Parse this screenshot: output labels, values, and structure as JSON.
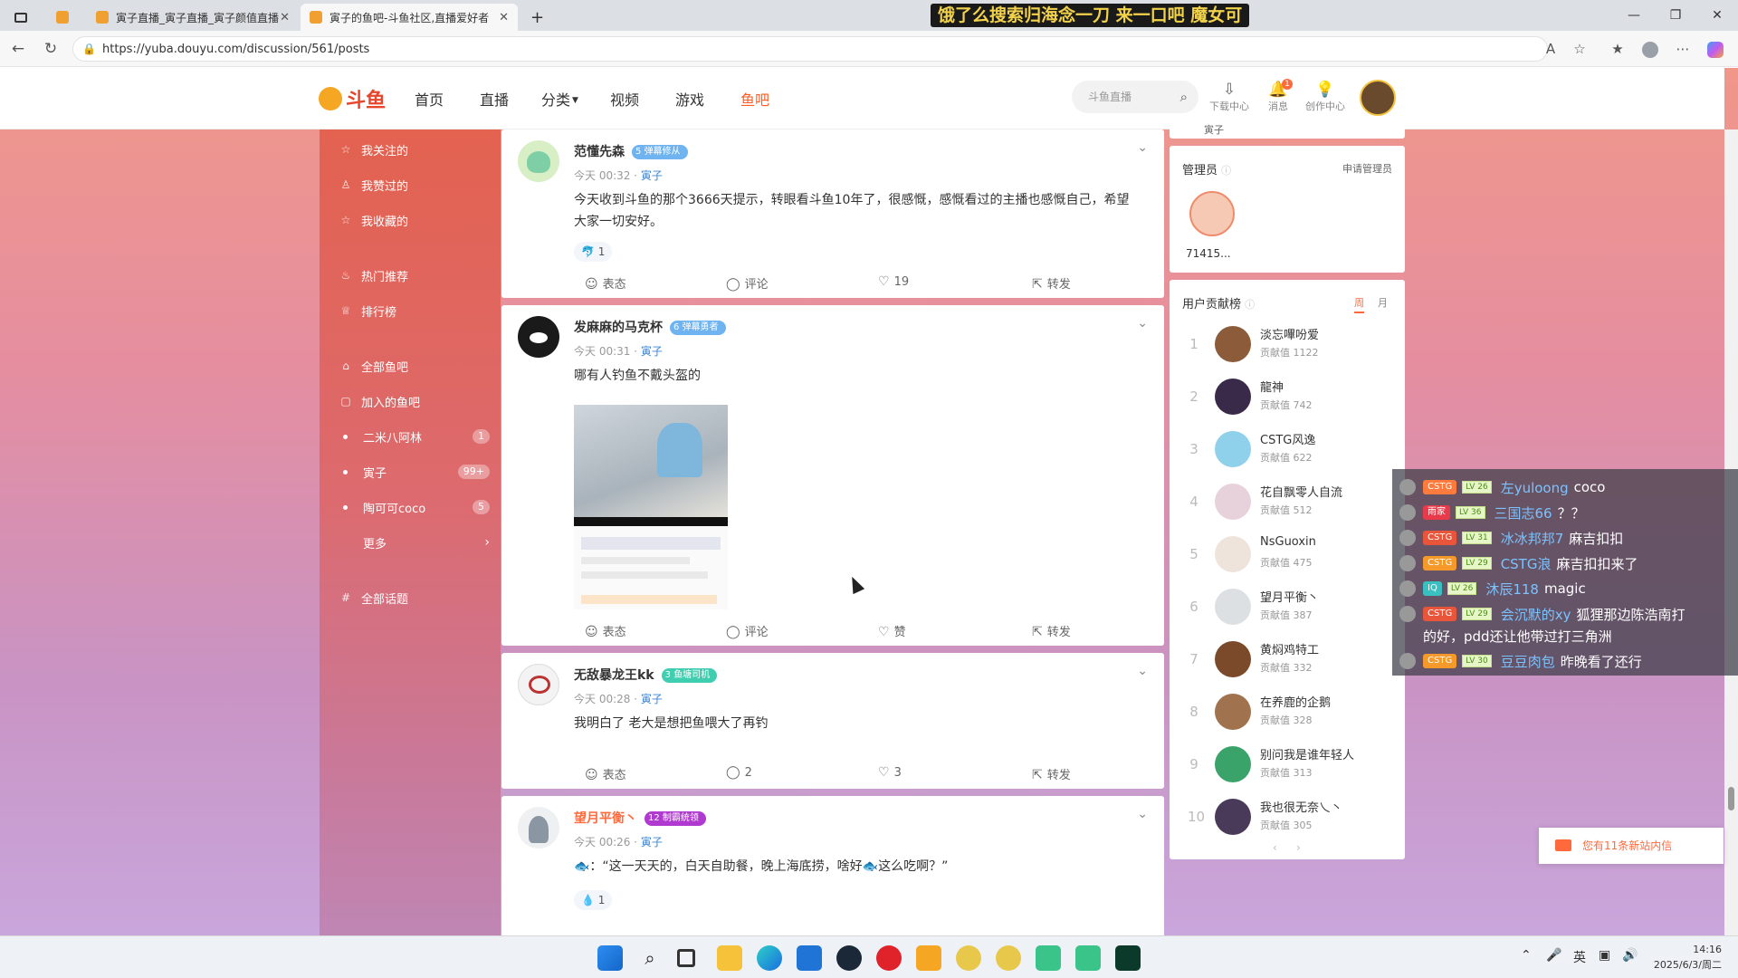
{
  "browser": {
    "tabs": [
      {
        "label": ""
      },
      {
        "label": "寅子直播_寅子直播_寅子颜值直播"
      },
      {
        "label": "寅子的鱼吧-斗鱼社区,直播爱好者"
      }
    ],
    "new_tab": "+",
    "overlay_title": "饿了么搜索归海念一刀 来一口吧 魔女可",
    "url": "https://yuba.douyu.com/discussion/561/posts",
    "minimize": "—",
    "maximize": "❐",
    "close": "✕"
  },
  "site": {
    "logo": "斗鱼",
    "nav": [
      "首页",
      "直播",
      "分类",
      "视频",
      "游戏",
      "鱼吧"
    ],
    "search_placeholder": "斗鱼直播",
    "icons": [
      {
        "label": "下载中心"
      },
      {
        "label": "消息",
        "badge": "1"
      },
      {
        "label": "创作中心"
      }
    ]
  },
  "sidebar": {
    "items": [
      {
        "label": "我关注的"
      },
      {
        "label": "我赞过的"
      },
      {
        "label": "我收藏的"
      },
      {
        "label": "热门推荐"
      },
      {
        "label": "排行榜"
      },
      {
        "label": "全部鱼吧"
      },
      {
        "label": "加入的鱼吧"
      },
      {
        "label": "二米八阿林",
        "count": "1"
      },
      {
        "label": "寅子",
        "count": "99+"
      },
      {
        "label": "陶可可coco",
        "count": "5"
      },
      {
        "label": "更多"
      },
      {
        "label": "全部话题"
      }
    ]
  },
  "posts": [
    {
      "user": "范懂先森",
      "lv": "5",
      "tag": "弹幕修从",
      "time": "今天 00:32",
      "bar": "寅子",
      "text": "今天收到斗鱼的那个3666天提示，转眼看斗鱼10年了，很感慨，感慨看过的主播也感慨自己，希望大家一切安好。",
      "react": "1",
      "actions": [
        "表态",
        "评论",
        "19",
        "转发"
      ]
    },
    {
      "user": "发麻麻的马克杯",
      "lv": "6",
      "tag": "弹幕勇者",
      "time": "今天 00:31",
      "bar": "寅子",
      "text": "哪有人钓鱼不戴头盔的",
      "actions": [
        "表态",
        "评论",
        "赞",
        "转发"
      ]
    },
    {
      "user": "无敌暴龙王kk",
      "lv": "3",
      "tag": "鱼塘司机",
      "time": "今天 00:28",
      "bar": "寅子",
      "text": "我明白了 老大是想把鱼喂大了再钓",
      "actions": [
        "表态",
        "2",
        "3",
        "转发"
      ]
    },
    {
      "user": "望月平衡丶",
      "lv": "12",
      "tag": "制霸统领",
      "time": "今天 00:26",
      "bar": "寅子",
      "text": "🐟：“这一天天的，白天自助餐，晚上海底捞，啥好🐟这么吃啊？”",
      "react": "1"
    }
  ],
  "rightcol": {
    "top_snip": "寅子",
    "admin_title": "管理员",
    "admin_link": "申请管理员",
    "admin_name": "71415...",
    "rank_title": "用户贡献榜",
    "rank_tabs": [
      "周",
      "月"
    ],
    "rank": [
      {
        "no": "1",
        "name": "淡忘嗶吩爱",
        "score": "贡献值 1122"
      },
      {
        "no": "2",
        "name": "龍神",
        "score": "贡献值 742"
      },
      {
        "no": "3",
        "name": "CSTG风逸",
        "score": "贡献值 622"
      },
      {
        "no": "4",
        "name": "花自飘零人自流",
        "score": "贡献值 512"
      },
      {
        "no": "5",
        "name": "NsGuoxin",
        "score": "贡献值 475"
      },
      {
        "no": "6",
        "name": "望月平衡丶",
        "score": "贡献值 387"
      },
      {
        "no": "7",
        "name": "黄焖鸡特工",
        "score": "贡献值 332"
      },
      {
        "no": "8",
        "name": "在养鹿的企鹅",
        "score": "贡献值 328"
      },
      {
        "no": "9",
        "name": "别问我是谁年轻人",
        "score": "贡献值 313"
      },
      {
        "no": "10",
        "name": "我也很无奈乀丶",
        "score": "贡献值 305"
      }
    ]
  },
  "danmu": [
    {
      "clan": "CSTG",
      "lv": "LV 26",
      "nick": "左yuloong",
      "msg": "coco"
    },
    {
      "clan": "雨家",
      "lv": "LV 36",
      "nick": "三国志66",
      "msg": "？？"
    },
    {
      "clan": "CSTG",
      "lv": "LV 31",
      "nick": "冰冰邦邦7",
      "msg": "麻吉扣扣"
    },
    {
      "clan": "CSTG",
      "lv": "LV 29",
      "nick": "CSTG浪",
      "msg": "麻吉扣扣来了"
    },
    {
      "clan": "IQ",
      "lv": "LV 26",
      "nick": "沐辰118",
      "msg": "magic"
    },
    {
      "clan": "CSTG",
      "lv": "LV 29",
      "nick": "会沉默的xy",
      "msg": "狐狸那边陈浩南打"
    },
    {
      "cont": "的好，pdd还让他带过打三角洲"
    },
    {
      "clan": "CSTG",
      "lv": "LV 30",
      "nick": "豆豆肉包",
      "msg": "昨晚看了还行"
    }
  ],
  "message_popup": "您有11条新站内信",
  "taskbar": {
    "lang": "英",
    "time": "14:16",
    "date": "2025/6/3/周二"
  },
  "colors": {
    "accent": "#ff5d23",
    "sidebar_top": "#e36250",
    "link": "#3a86d6"
  }
}
